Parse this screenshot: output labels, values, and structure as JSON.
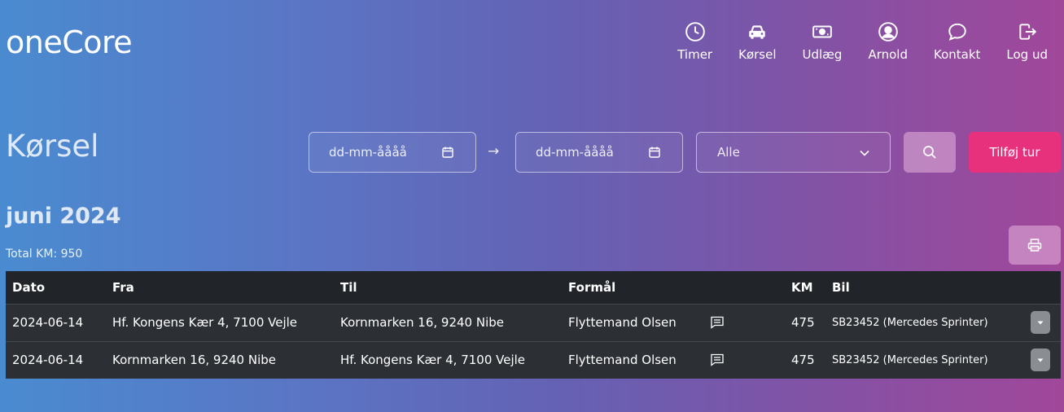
{
  "app": {
    "logo": "oneCore"
  },
  "nav": [
    {
      "label": "Timer",
      "icon": "clock-icon"
    },
    {
      "label": "Kørsel",
      "icon": "car-icon"
    },
    {
      "label": "Udlæg",
      "icon": "money-icon"
    },
    {
      "label": "Arnold",
      "icon": "user-icon"
    },
    {
      "label": "Kontakt",
      "icon": "chat-icon"
    },
    {
      "label": "Log ud",
      "icon": "logout-icon"
    }
  ],
  "page": {
    "title": "Kørsel"
  },
  "filters": {
    "date_from_placeholder": "dd-mm-åååå",
    "date_to_placeholder": "dd-mm-åååå",
    "arrow": "→",
    "select_value": "Alle",
    "add_label": "Tilføj tur"
  },
  "summary": {
    "month": "juni 2024",
    "total": "Total KM: 950"
  },
  "table": {
    "headers": [
      "Dato",
      "Fra",
      "Til",
      "Formål",
      "",
      "KM",
      "Bil"
    ],
    "rows": [
      {
        "dato": "2024-06-14",
        "fra": "Hf. Kongens Kær 4, 7100 Vejle",
        "til": "Kornmarken 16, 9240 Nibe",
        "formaal": "Flyttemand Olsen",
        "km": "475",
        "bil": "SB23452 (Mercedes Sprinter)"
      },
      {
        "dato": "2024-06-14",
        "fra": "Kornmarken 16, 9240 Nibe",
        "til": "Hf. Kongens Kær 4, 7100 Vejle",
        "formaal": "Flyttemand Olsen",
        "km": "475",
        "bil": "SB23452 (Mercedes Sprinter)"
      }
    ]
  },
  "colors": {
    "accent": "#e8317c",
    "table_header": "#212529",
    "table_row": "#2c3034"
  }
}
